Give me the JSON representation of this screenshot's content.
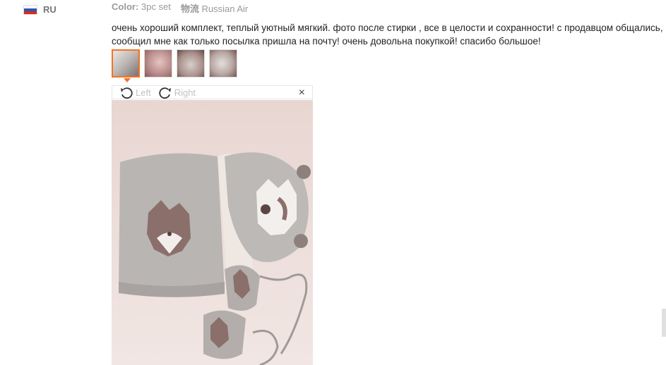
{
  "reviewer": {
    "country_code": "RU"
  },
  "meta": {
    "color_label": "Color:",
    "color_value": "3pc set",
    "shipping_label": "物流",
    "shipping_value": "Russian Air"
  },
  "review_text": "очень хороший комплект, теплый уютный мягкий. фото после стирки , все в целости и сохранности! с продавцом общались,\nсообщил мне как только посылка пришла на почту! очень довольна покупкой! спасибо большое!",
  "viewer": {
    "rotate_left_label": "Left",
    "rotate_right_label": "Right",
    "close_label": "×"
  },
  "colors": {
    "accent": "#f57224",
    "muted_text": "#999999"
  },
  "thumbnails_count": 4
}
